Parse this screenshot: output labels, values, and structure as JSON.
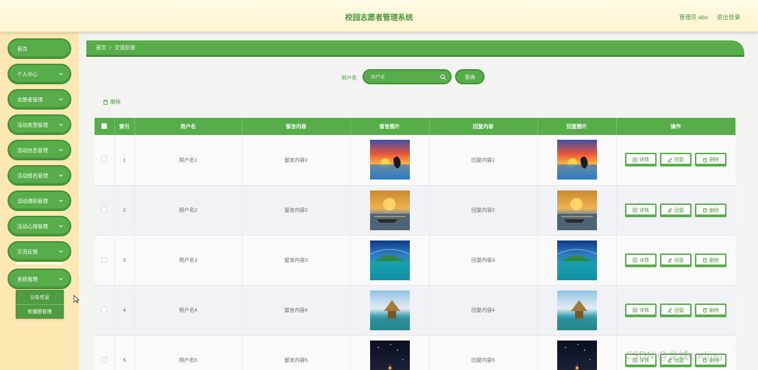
{
  "header": {
    "title": "校园志愿者管理系统",
    "user": "管理员 abo",
    "logout": "退出登录"
  },
  "sidebar": {
    "items": [
      {
        "label": "首页",
        "has_arrow": false
      },
      {
        "label": "个人中心",
        "has_arrow": true
      },
      {
        "label": "志愿者管理",
        "has_arrow": true
      },
      {
        "label": "活动类型管理",
        "has_arrow": true
      },
      {
        "label": "活动信息管理",
        "has_arrow": true
      },
      {
        "label": "活动报名管理",
        "has_arrow": true
      },
      {
        "label": "活动通知管理",
        "has_arrow": true
      },
      {
        "label": "活动心得管理",
        "has_arrow": true
      },
      {
        "label": "交流反馈",
        "has_arrow": true
      },
      {
        "label": "系统管理",
        "has_arrow": true
      }
    ],
    "submenu": [
      "公告信息",
      "轮播图管理"
    ]
  },
  "breadcrumb": {
    "home": "首页",
    "separator": "/",
    "current": "交流反馈"
  },
  "search": {
    "label": "用户名",
    "placeholder": "用户名",
    "button": "查询"
  },
  "toolbar": {
    "delete": "删除"
  },
  "table": {
    "headers": [
      "索引",
      "用户名",
      "留言内容",
      "留言图片",
      "回复内容",
      "回复图片",
      "操作"
    ],
    "actions": {
      "detail": "详情",
      "reply": "回复",
      "delete": "删除"
    },
    "rows": [
      {
        "index": "1",
        "username": "用户名1",
        "message": "留言内容1",
        "reply": "回复内容1",
        "image": "sunset-hand-photo"
      },
      {
        "index": "2",
        "username": "用户名2",
        "message": "留言内容2",
        "reply": "回复内容2",
        "image": "harbor-sunset-photo"
      },
      {
        "index": "3",
        "username": "用户名3",
        "message": "留言内容3",
        "reply": "回复内容3",
        "image": "tropical-island-photo"
      },
      {
        "index": "4",
        "username": "用户名4",
        "message": "留言内容4",
        "reply": "回复内容4",
        "image": "beach-hut-photo"
      },
      {
        "index": "5",
        "username": "用户名5",
        "message": "留言内容5",
        "reply": "回复内容5",
        "image": "night-sky-photo"
      }
    ]
  },
  "watermark": "CSDN @龙城coding",
  "colors": {
    "accent": "#57ad4a",
    "accent_dark": "#3f8f33",
    "sidebar_bg": "#fde8b4",
    "header_bg": "#fffbe4"
  }
}
